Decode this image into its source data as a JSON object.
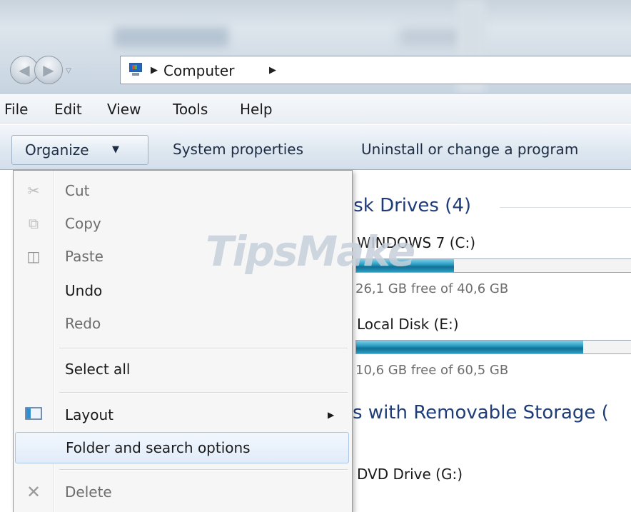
{
  "address": {
    "breadcrumbs": [
      "Computer"
    ]
  },
  "menubar": {
    "items": [
      "File",
      "Edit",
      "View",
      "Tools",
      "Help"
    ]
  },
  "toolbar": {
    "organize_label": "Organize",
    "buttons": [
      "System properties",
      "Uninstall or change a program"
    ]
  },
  "organize_menu": {
    "items": [
      {
        "label": "Cut",
        "enabled": false,
        "icon": "scissors-icon"
      },
      {
        "label": "Copy",
        "enabled": false,
        "icon": "copy-icon"
      },
      {
        "label": "Paste",
        "enabled": false,
        "icon": "paste-icon"
      },
      {
        "label": "Undo",
        "enabled": true
      },
      {
        "label": "Redo",
        "enabled": false
      },
      {
        "label": "Select all",
        "enabled": true
      },
      {
        "label": "Layout",
        "enabled": true,
        "icon": "layout-icon",
        "submenu": true
      },
      {
        "label": "Folder and search options",
        "enabled": true,
        "highlighted": true
      },
      {
        "label": "Delete",
        "enabled": false,
        "icon": "delete-icon"
      }
    ]
  },
  "content": {
    "hard_disk_header": "isk Drives (4)",
    "drives": [
      {
        "name": "WINDOWS 7 (C:)",
        "free_text": "26,1 GB free of 40,6 GB",
        "used_fraction": 0.357
      },
      {
        "name": "Local Disk (E:)",
        "free_text": "10,6 GB free of 60,5 GB",
        "used_fraction": 0.825
      }
    ],
    "removable_header": "s with Removable Storage (",
    "removable": [
      {
        "name": "DVD Drive (G:)"
      }
    ]
  },
  "watermark": "TipsMake"
}
